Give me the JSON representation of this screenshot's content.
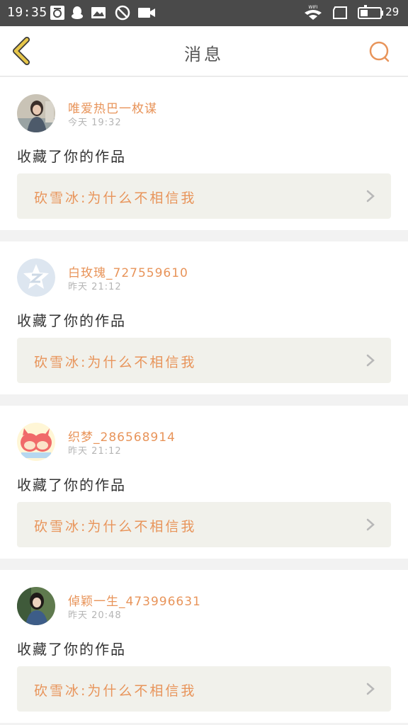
{
  "status_bar": {
    "time": "19:35",
    "battery": "29",
    "wifi_label": "WIFI"
  },
  "header": {
    "title": "消息"
  },
  "messages": [
    {
      "username": "唯爱热巴一枚谋",
      "time": "今天 19:32",
      "action": "收藏了你的作品",
      "work": "砍雪冰:为什么不相信我"
    },
    {
      "username": "白玫瑰_727559610",
      "time": "昨天 21:12",
      "action": "收藏了你的作品",
      "work": "砍雪冰:为什么不相信我"
    },
    {
      "username": "织梦_286568914",
      "time": "昨天 21:12",
      "action": "收藏了你的作品",
      "work": "砍雪冰:为什么不相信我"
    },
    {
      "username": "倬颖一生_473996631",
      "time": "昨天 20:48",
      "action": "收藏了你的作品",
      "work": "砍雪冰:为什么不相信我"
    }
  ],
  "colors": {
    "accent": "#e8945a",
    "back_arrow": "#e6c64a",
    "status_bar": "#4a4a4a",
    "card_box": "#f1f1eb"
  }
}
